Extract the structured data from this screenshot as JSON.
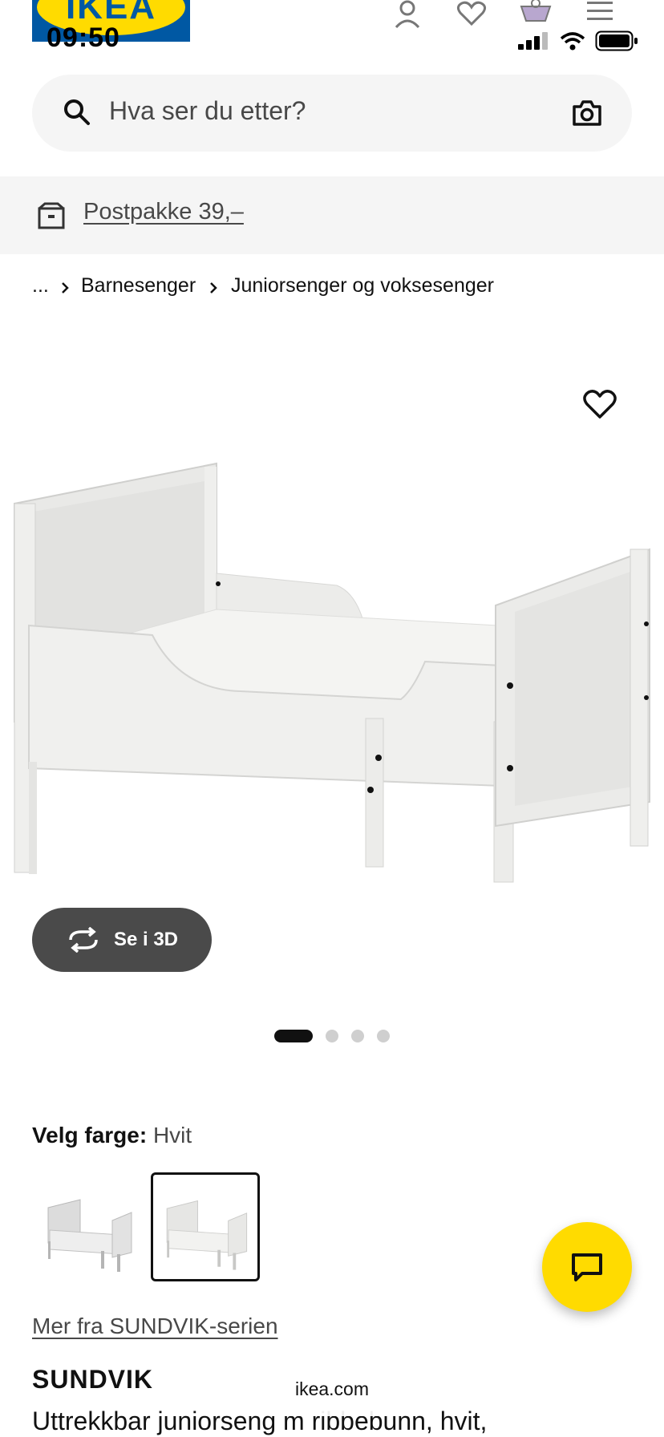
{
  "status_bar": {
    "time": "09:50"
  },
  "header": {
    "logo_text": "IKEA"
  },
  "search": {
    "placeholder": "Hva ser du etter?"
  },
  "shipping": {
    "label": "Postpakke 39,–"
  },
  "breadcrumb": {
    "ellipsis": "...",
    "items": [
      "Barnesenger",
      "Juniorsenger og voksesenger"
    ]
  },
  "gallery": {
    "view_3d_label": "Se i 3D",
    "page_count": 4,
    "active_page": 1
  },
  "color_selector": {
    "label": "Velg farge:",
    "selected": "Hvit",
    "selected_index": 2
  },
  "series_link": "Mer fra SUNDVIK-serien",
  "product": {
    "name": "SUNDVIK",
    "description": "Uttrekkbar juniorseng m ribbebunn, hvit,"
  },
  "browser": {
    "url": "ikea.com"
  },
  "colors": {
    "brand_blue": "#0058a3",
    "brand_yellow": "#ffdb00",
    "dark_button": "#4a4a4a"
  }
}
